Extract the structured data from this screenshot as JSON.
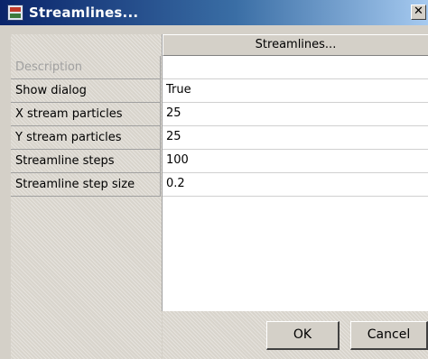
{
  "window": {
    "title": "Streamlines...",
    "close_glyph": "✕"
  },
  "grid": {
    "header": "Streamlines...",
    "rows": [
      {
        "label": "Description",
        "value": "",
        "disabled": true
      },
      {
        "label": "Show dialog",
        "value": "True"
      },
      {
        "label": "X stream particles",
        "value": "25"
      },
      {
        "label": "Y stream particles",
        "value": "25"
      },
      {
        "label": "Streamline steps",
        "value": "100"
      },
      {
        "label": "Streamline step size",
        "value": "0.2"
      }
    ]
  },
  "buttons": {
    "ok": "OK",
    "cancel": "Cancel"
  },
  "icons": {
    "app": "grid-app-icon",
    "close": "close-icon"
  }
}
